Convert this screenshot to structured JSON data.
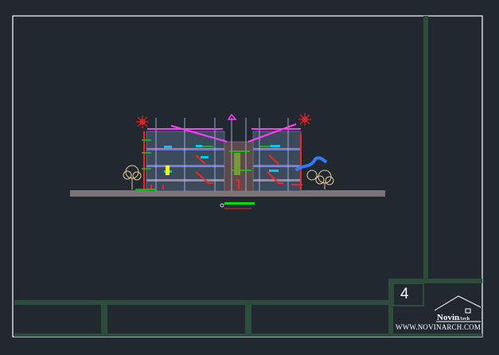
{
  "sheet": {
    "number": "4"
  },
  "brand": {
    "name": "Novin",
    "name_suffix": "Arch",
    "url": "WWW.NOVINARCH.COM"
  },
  "drawing": {
    "type": "architectural section (CAD)",
    "floors": 3,
    "colors": {
      "background": "#212830",
      "frame": "#ffffff",
      "title_block": "#2c4c3c",
      "ground": "#7c7577",
      "slab": "#9a8aa8",
      "magenta": "#ff3cff",
      "red": "#ff2020",
      "green": "#00e000",
      "cyan": "#00c8ff",
      "blue": "#3c6cff",
      "yellow": "#ffff00"
    }
  }
}
